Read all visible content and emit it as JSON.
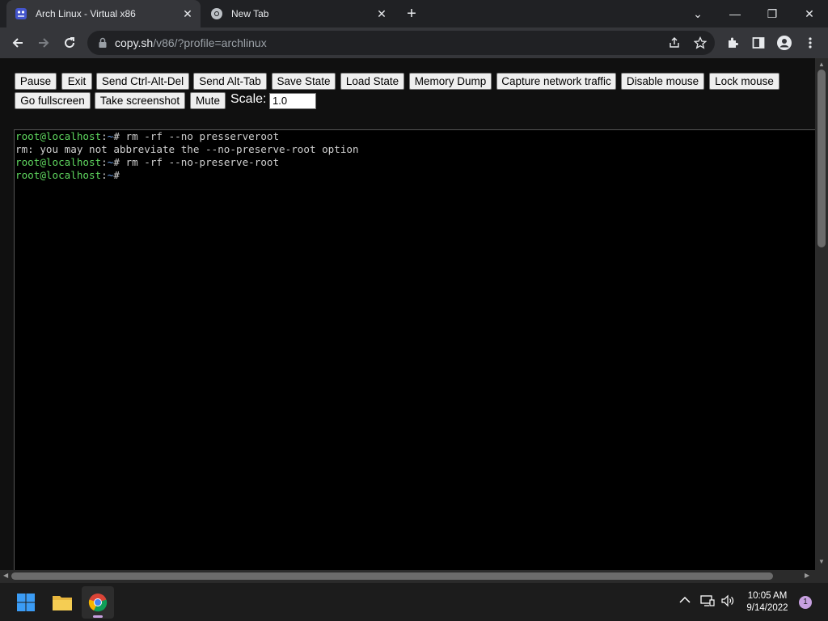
{
  "browser": {
    "tabs": [
      {
        "title": "Arch Linux - Virtual x86",
        "active": true
      },
      {
        "title": "New Tab",
        "active": false
      }
    ],
    "url_host": "copy.sh",
    "url_path": "/v86/?profile=archlinux"
  },
  "controls": {
    "pause": "Pause",
    "exit": "Exit",
    "ctrl_alt_del": "Send Ctrl-Alt-Del",
    "alt_tab": "Send Alt-Tab",
    "save_state": "Save State",
    "load_state": "Load State",
    "memory_dump": "Memory Dump",
    "capture_network": "Capture network traffic",
    "disable_mouse": "Disable mouse",
    "lock_mouse": "Lock mouse",
    "fullscreen": "Go fullscreen",
    "screenshot": "Take screenshot",
    "mute": "Mute",
    "scale_label": "Scale:",
    "scale_value": "1.0"
  },
  "terminal": {
    "prompt_user": "root@localhost",
    "prompt_tilde": "~",
    "lines": [
      {
        "type": "prompt",
        "cmd": "# rm -rf --no presserveroot"
      },
      {
        "type": "output",
        "text": "rm: you may not abbreviate the --no-preserve-root option"
      },
      {
        "type": "prompt",
        "cmd": "# rm -rf --no-preserve-root"
      },
      {
        "type": "prompt",
        "cmd": "#"
      }
    ]
  },
  "taskbar": {
    "time": "10:05 AM",
    "date": "9/14/2022",
    "notifications": "1"
  },
  "colors": {
    "prompt_green": "#5fd75f",
    "tilde_blue": "#6ca0e8",
    "terminal_bg": "#000000"
  }
}
